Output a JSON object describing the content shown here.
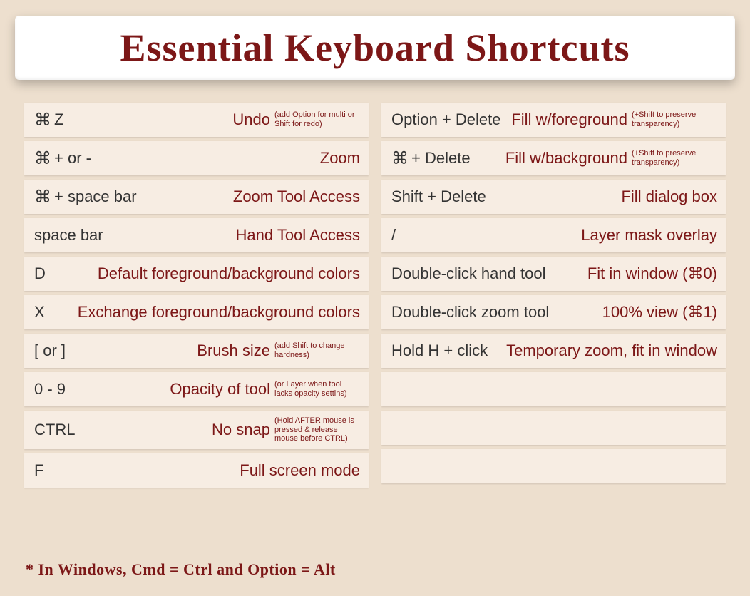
{
  "title": "Essential Keyboard Shortcuts",
  "footer": "* In Windows, Cmd = Ctrl and Option = Alt",
  "left": [
    {
      "keys_prefix_cmd": true,
      "keys": "Z",
      "desc": "Undo",
      "note": "(add Option for multi or Shift for redo)"
    },
    {
      "keys_prefix_cmd": true,
      "keys": " + or -",
      "desc": "Zoom",
      "note": ""
    },
    {
      "keys_prefix_cmd": true,
      "keys": " + space bar",
      "desc": "Zoom Tool Access",
      "note": ""
    },
    {
      "keys_prefix_cmd": false,
      "keys": "space bar",
      "desc": "Hand Tool Access",
      "note": ""
    },
    {
      "keys_prefix_cmd": false,
      "keys": "D",
      "desc": "Default foreground/background colors",
      "note": ""
    },
    {
      "keys_prefix_cmd": false,
      "keys": "X",
      "desc": "Exchange foreground/background colors",
      "note": ""
    },
    {
      "keys_prefix_cmd": false,
      "keys": "[ or ]",
      "desc": "Brush size",
      "note": "(add Shift to change hardness)"
    },
    {
      "keys_prefix_cmd": false,
      "keys": "0 - 9",
      "desc": "Opacity of tool",
      "note": "(or Layer when tool lacks opacity settins)"
    },
    {
      "keys_prefix_cmd": false,
      "keys": "CTRL",
      "desc": "No snap",
      "note": "(Hold AFTER mouse is pressed & release mouse before CTRL)"
    },
    {
      "keys_prefix_cmd": false,
      "keys": "F",
      "desc": "Full screen mode",
      "note": ""
    }
  ],
  "right": [
    {
      "keys_prefix_cmd": false,
      "keys": "Option + Delete",
      "desc": "Fill w/foreground",
      "note": "(+Shift to preserve transparency)"
    },
    {
      "keys_prefix_cmd": true,
      "keys": " + Delete",
      "desc": "Fill w/background",
      "note": "(+Shift to preserve transparency)"
    },
    {
      "keys_prefix_cmd": false,
      "keys": "Shift + Delete",
      "desc": "Fill dialog box",
      "note": ""
    },
    {
      "keys_prefix_cmd": false,
      "keys": "/",
      "desc": "Layer mask overlay",
      "note": ""
    },
    {
      "keys_prefix_cmd": false,
      "keys": "Double-click hand tool",
      "desc": "Fit in window (⌘0)",
      "note": ""
    },
    {
      "keys_prefix_cmd": false,
      "keys": "Double-click zoom tool",
      "desc": "100% view (⌘1)",
      "note": ""
    },
    {
      "keys_prefix_cmd": false,
      "keys": "Hold H + click",
      "desc": "Temporary zoom, fit in window",
      "note": ""
    },
    {
      "empty": true
    },
    {
      "empty": true
    },
    {
      "empty": true
    }
  ]
}
